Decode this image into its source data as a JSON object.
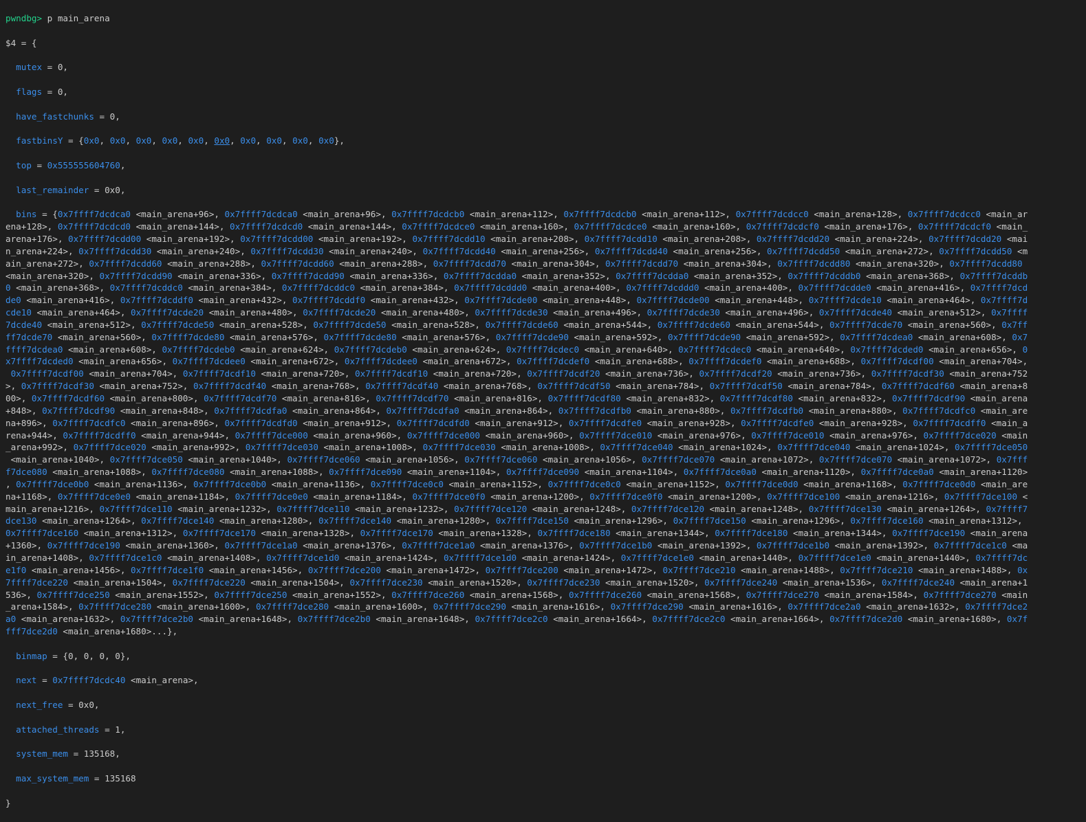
{
  "terminal": {
    "prompt": "pwndbg>",
    "command": " p main_arena",
    "result_open": "$4 = {",
    "closing_brace": "}",
    "fields": [
      {
        "name": "mutex",
        "value": " = 0,"
      },
      {
        "name": "flags",
        "value": " = 0,"
      },
      {
        "name": "have_fastchunks",
        "value": " = 0,"
      }
    ],
    "fastbinsY": {
      "name": "fastbinsY",
      "prefix": " = {",
      "values": [
        "0x0",
        "0x0",
        "0x0",
        "0x0",
        "0x0",
        "0x0",
        "0x0",
        "0x0",
        "0x0",
        "0x0"
      ],
      "underlined_index": 5,
      "suffix": "},"
    },
    "top": {
      "name": "top",
      "prefix": " = ",
      "address": "0x555555604760",
      "suffix": ","
    },
    "last_remainder": {
      "name": "last_remainder",
      "value": " = 0x0,"
    },
    "bins_field": {
      "name": "bins",
      "prefix": " = {"
    },
    "bins_lines": [
      "0x7ffff7dcdca0 <main_arena+96>, 0x7ffff7dcdca0 <main_arena+96>, 0x7ffff7dcdcb0 <main_arena+112>, 0x7ffff7dcdcb0 <main_arena+112>, 0x7ffff7dcdcc0 <main_arena+128>, 0x7ffff7dcdcc0 <main_ar",
      "ena+128>, 0x7ffff7dcdcd0 <main_arena+144>, 0x7ffff7dcdcd0 <main_arena+144>, 0x7ffff7dcdce0 <main_arena+160>, 0x7ffff7dcdce0 <main_arena+160>, 0x7ffff7dcdcf0 <main_arena+176>, 0x7ffff7dcdcf0 <main_",
      "arena+176>, 0x7ffff7dcdd00 <main_arena+192>, 0x7ffff7dcdd00 <main_arena+192>, 0x7ffff7dcdd10 <main_arena+208>, 0x7ffff7dcdd10 <main_arena+208>, 0x7ffff7dcdd20 <main_arena+224>, 0x7ffff7dcdd20 <mai",
      "n_arena+224>, 0x7ffff7dcdd30 <main_arena+240>, 0x7ffff7dcdd30 <main_arena+240>, 0x7ffff7dcdd40 <main_arena+256>, 0x7ffff7dcdd40 <main_arena+256>, 0x7ffff7dcdd50 <main_arena+272>, 0x7ffff7dcdd50 <m",
      "ain_arena+272>, 0x7ffff7dcdd60 <main_arena+288>, 0x7ffff7dcdd60 <main_arena+288>, 0x7ffff7dcdd70 <main_arena+304>, 0x7ffff7dcdd70 <main_arena+304>, 0x7ffff7dcdd80 <main_arena+320>, 0x7ffff7dcdd80 ",
      "<main_arena+320>, 0x7ffff7dcdd90 <main_arena+336>, 0x7ffff7dcdd90 <main_arena+336>, 0x7ffff7dcdda0 <main_arena+352>, 0x7ffff7dcdda0 <main_arena+352>, 0x7ffff7dcddb0 <main_arena+368>, 0x7ffff7dcddb",
      "0 <main_arena+368>, 0x7ffff7dcddc0 <main_arena+384>, 0x7ffff7dcddc0 <main_arena+384>, 0x7ffff7dcddd0 <main_arena+400>, 0x7ffff7dcddd0 <main_arena+400>, 0x7ffff7dcdde0 <main_arena+416>, 0x7ffff7dcd",
      "de0 <main_arena+416>, 0x7ffff7dcddf0 <main_arena+432>, 0x7ffff7dcddf0 <main_arena+432>, 0x7ffff7dcde00 <main_arena+448>, 0x7ffff7dcde00 <main_arena+448>, 0x7ffff7dcde10 <main_arena+464>, 0x7ffff7d",
      "cde10 <main_arena+464>, 0x7ffff7dcde20 <main_arena+480>, 0x7ffff7dcde20 <main_arena+480>, 0x7ffff7dcde30 <main_arena+496>, 0x7ffff7dcde30 <main_arena+496>, 0x7ffff7dcde40 <main_arena+512>, 0x7ffff",
      "7dcde40 <main_arena+512>, 0x7ffff7dcde50 <main_arena+528>, 0x7ffff7dcde50 <main_arena+528>, 0x7ffff7dcde60 <main_arena+544>, 0x7ffff7dcde60 <main_arena+544>, 0x7ffff7dcde70 <main_arena+560>, 0x7ff",
      "ff7dcde70 <main_arena+560>, 0x7ffff7dcde80 <main_arena+576>, 0x7ffff7dcde80 <main_arena+576>, 0x7ffff7dcde90 <main_arena+592>, 0x7ffff7dcde90 <main_arena+592>, 0x7ffff7dcdea0 <main_arena+608>, 0x7",
      "ffff7dcdea0 <main_arena+608>, 0x7ffff7dcdeb0 <main_arena+624>, 0x7ffff7dcdeb0 <main_arena+624>, 0x7ffff7dcdec0 <main_arena+640>, 0x7ffff7dcdec0 <main_arena+640>, 0x7ffff7dcded0 <main_arena+656>, 0",
      "x7ffff7dcded0 <main_arena+656>, 0x7ffff7dcdee0 <main_arena+672>, 0x7ffff7dcdee0 <main_arena+672>, 0x7ffff7dcdef0 <main_arena+688>, 0x7ffff7dcdef0 <main_arena+688>, 0x7ffff7dcdf00 <main_arena+704>,",
      " 0x7ffff7dcdf00 <main_arena+704>, 0x7ffff7dcdf10 <main_arena+720>, 0x7ffff7dcdf10 <main_arena+720>, 0x7ffff7dcdf20 <main_arena+736>, 0x7ffff7dcdf20 <main_arena+736>, 0x7ffff7dcdf30 <main_arena+752",
      ">, 0x7ffff7dcdf30 <main_arena+752>, 0x7ffff7dcdf40 <main_arena+768>, 0x7ffff7dcdf40 <main_arena+768>, 0x7ffff7dcdf50 <main_arena+784>, 0x7ffff7dcdf50 <main_arena+784>, 0x7ffff7dcdf60 <main_arena+8",
      "00>, 0x7ffff7dcdf60 <main_arena+800>, 0x7ffff7dcdf70 <main_arena+816>, 0x7ffff7dcdf70 <main_arena+816>, 0x7ffff7dcdf80 <main_arena+832>, 0x7ffff7dcdf80 <main_arena+832>, 0x7ffff7dcdf90 <main_arena",
      "+848>, 0x7ffff7dcdf90 <main_arena+848>, 0x7ffff7dcdfa0 <main_arena+864>, 0x7ffff7dcdfa0 <main_arena+864>, 0x7ffff7dcdfb0 <main_arena+880>, 0x7ffff7dcdfb0 <main_arena+880>, 0x7ffff7dcdfc0 <main_are",
      "na+896>, 0x7ffff7dcdfc0 <main_arena+896>, 0x7ffff7dcdfd0 <main_arena+912>, 0x7ffff7dcdfd0 <main_arena+912>, 0x7ffff7dcdfe0 <main_arena+928>, 0x7ffff7dcdfe0 <main_arena+928>, 0x7ffff7dcdff0 <main_a",
      "rena+944>, 0x7ffff7dcdff0 <main_arena+944>, 0x7ffff7dce000 <main_arena+960>, 0x7ffff7dce000 <main_arena+960>, 0x7ffff7dce010 <main_arena+976>, 0x7ffff7dce010 <main_arena+976>, 0x7ffff7dce020 <main",
      "_arena+992>, 0x7ffff7dce020 <main_arena+992>, 0x7ffff7dce030 <main_arena+1008>, 0x7ffff7dce030 <main_arena+1008>, 0x7ffff7dce040 <main_arena+1024>, 0x7ffff7dce040 <main_arena+1024>, 0x7ffff7dce050",
      " <main_arena+1040>, 0x7ffff7dce050 <main_arena+1040>, 0x7ffff7dce060 <main_arena+1056>, 0x7ffff7dce060 <main_arena+1056>, 0x7ffff7dce070 <main_arena+1072>, 0x7ffff7dce070 <main_arena+1072>, 0x7fff",
      "f7dce080 <main_arena+1088>, 0x7ffff7dce080 <main_arena+1088>, 0x7ffff7dce090 <main_arena+1104>, 0x7ffff7dce090 <main_arena+1104>, 0x7ffff7dce0a0 <main_arena+1120>, 0x7ffff7dce0a0 <main_arena+1120>",
      ", 0x7ffff7dce0b0 <main_arena+1136>, 0x7ffff7dce0b0 <main_arena+1136>, 0x7ffff7dce0c0 <main_arena+1152>, 0x7ffff7dce0c0 <main_arena+1152>, 0x7ffff7dce0d0 <main_arena+1168>, 0x7ffff7dce0d0 <main_are",
      "na+1168>, 0x7ffff7dce0e0 <main_arena+1184>, 0x7ffff7dce0e0 <main_arena+1184>, 0x7ffff7dce0f0 <main_arena+1200>, 0x7ffff7dce0f0 <main_arena+1200>, 0x7ffff7dce100 <main_arena+1216>, 0x7ffff7dce100 <",
      "main_arena+1216>, 0x7ffff7dce110 <main_arena+1232>, 0x7ffff7dce110 <main_arena+1232>, 0x7ffff7dce120 <main_arena+1248>, 0x7ffff7dce120 <main_arena+1248>, 0x7ffff7dce130 <main_arena+1264>, 0x7ffff7",
      "dce130 <main_arena+1264>, 0x7ffff7dce140 <main_arena+1280>, 0x7ffff7dce140 <main_arena+1280>, 0x7ffff7dce150 <main_arena+1296>, 0x7ffff7dce150 <main_arena+1296>, 0x7ffff7dce160 <main_arena+1312>,",
      "0x7ffff7dce160 <main_arena+1312>, 0x7ffff7dce170 <main_arena+1328>, 0x7ffff7dce170 <main_arena+1328>, 0x7ffff7dce180 <main_arena+1344>, 0x7ffff7dce180 <main_arena+1344>, 0x7ffff7dce190 <main_arena",
      "+1360>, 0x7ffff7dce190 <main_arena+1360>, 0x7ffff7dce1a0 <main_arena+1376>, 0x7ffff7dce1a0 <main_arena+1376>, 0x7ffff7dce1b0 <main_arena+1392>, 0x7ffff7dce1b0 <main_arena+1392>, 0x7ffff7dce1c0 <ma",
      "in_arena+1408>, 0x7ffff7dce1c0 <main_arena+1408>, 0x7ffff7dce1d0 <main_arena+1424>, 0x7ffff7dce1d0 <main_arena+1424>, 0x7ffff7dce1e0 <main_arena+1440>, 0x7ffff7dce1e0 <main_arena+1440>, 0x7ffff7dc",
      "e1f0 <main_arena+1456>, 0x7ffff7dce1f0 <main_arena+1456>, 0x7ffff7dce200 <main_arena+1472>, 0x7ffff7dce200 <main_arena+1472>, 0x7ffff7dce210 <main_arena+1488>, 0x7ffff7dce210 <main_arena+1488>, 0x",
      "7ffff7dce220 <main_arena+1504>, 0x7ffff7dce220 <main_arena+1504>, 0x7ffff7dce230 <main_arena+1520>, 0x7ffff7dce230 <main_arena+1520>, 0x7ffff7dce240 <main_arena+1536>, 0x7ffff7dce240 <main_arena+1",
      "536>, 0x7ffff7dce250 <main_arena+1552>, 0x7ffff7dce250 <main_arena+1552>, 0x7ffff7dce260 <main_arena+1568>, 0x7ffff7dce260 <main_arena+1568>, 0x7ffff7dce270 <main_arena+1584>, 0x7ffff7dce270 <main",
      "_arena+1584>, 0x7ffff7dce280 <main_arena+1600>, 0x7ffff7dce280 <main_arena+1600>, 0x7ffff7dce290 <main_arena+1616>, 0x7ffff7dce290 <main_arena+1616>, 0x7ffff7dce2a0 <main_arena+1632>, 0x7ffff7dce2",
      "a0 <main_arena+1632>, 0x7ffff7dce2b0 <main_arena+1648>, 0x7ffff7dce2b0 <main_arena+1648>, 0x7ffff7dce2c0 <main_arena+1664>, 0x7ffff7dce2c0 <main_arena+1664>, 0x7ffff7dce2d0 <main_arena+1680>, 0x7f",
      "fff7dce2d0 <main_arena+1680>...},"
    ],
    "binmap": {
      "name": "binmap",
      "value": " = {0, 0, 0, 0},"
    },
    "next": {
      "name": "next",
      "prefix": " = ",
      "address": "0x7ffff7dcdc40",
      "symbol": " <main_arena>",
      "suffix": ","
    },
    "tail_fields": [
      {
        "name": "next_free",
        "value": " = 0x0,"
      },
      {
        "name": "attached_threads",
        "value": " = 1,"
      },
      {
        "name": "system_mem",
        "value": " = 135168,"
      },
      {
        "name": "max_system_mem",
        "value": " = 135168"
      }
    ],
    "colors": {
      "background": "#1e1e1e",
      "text": "#cccccc",
      "prompt": "#23d18b",
      "field_name": "#3b8eea",
      "address": "#3b8eea"
    }
  }
}
